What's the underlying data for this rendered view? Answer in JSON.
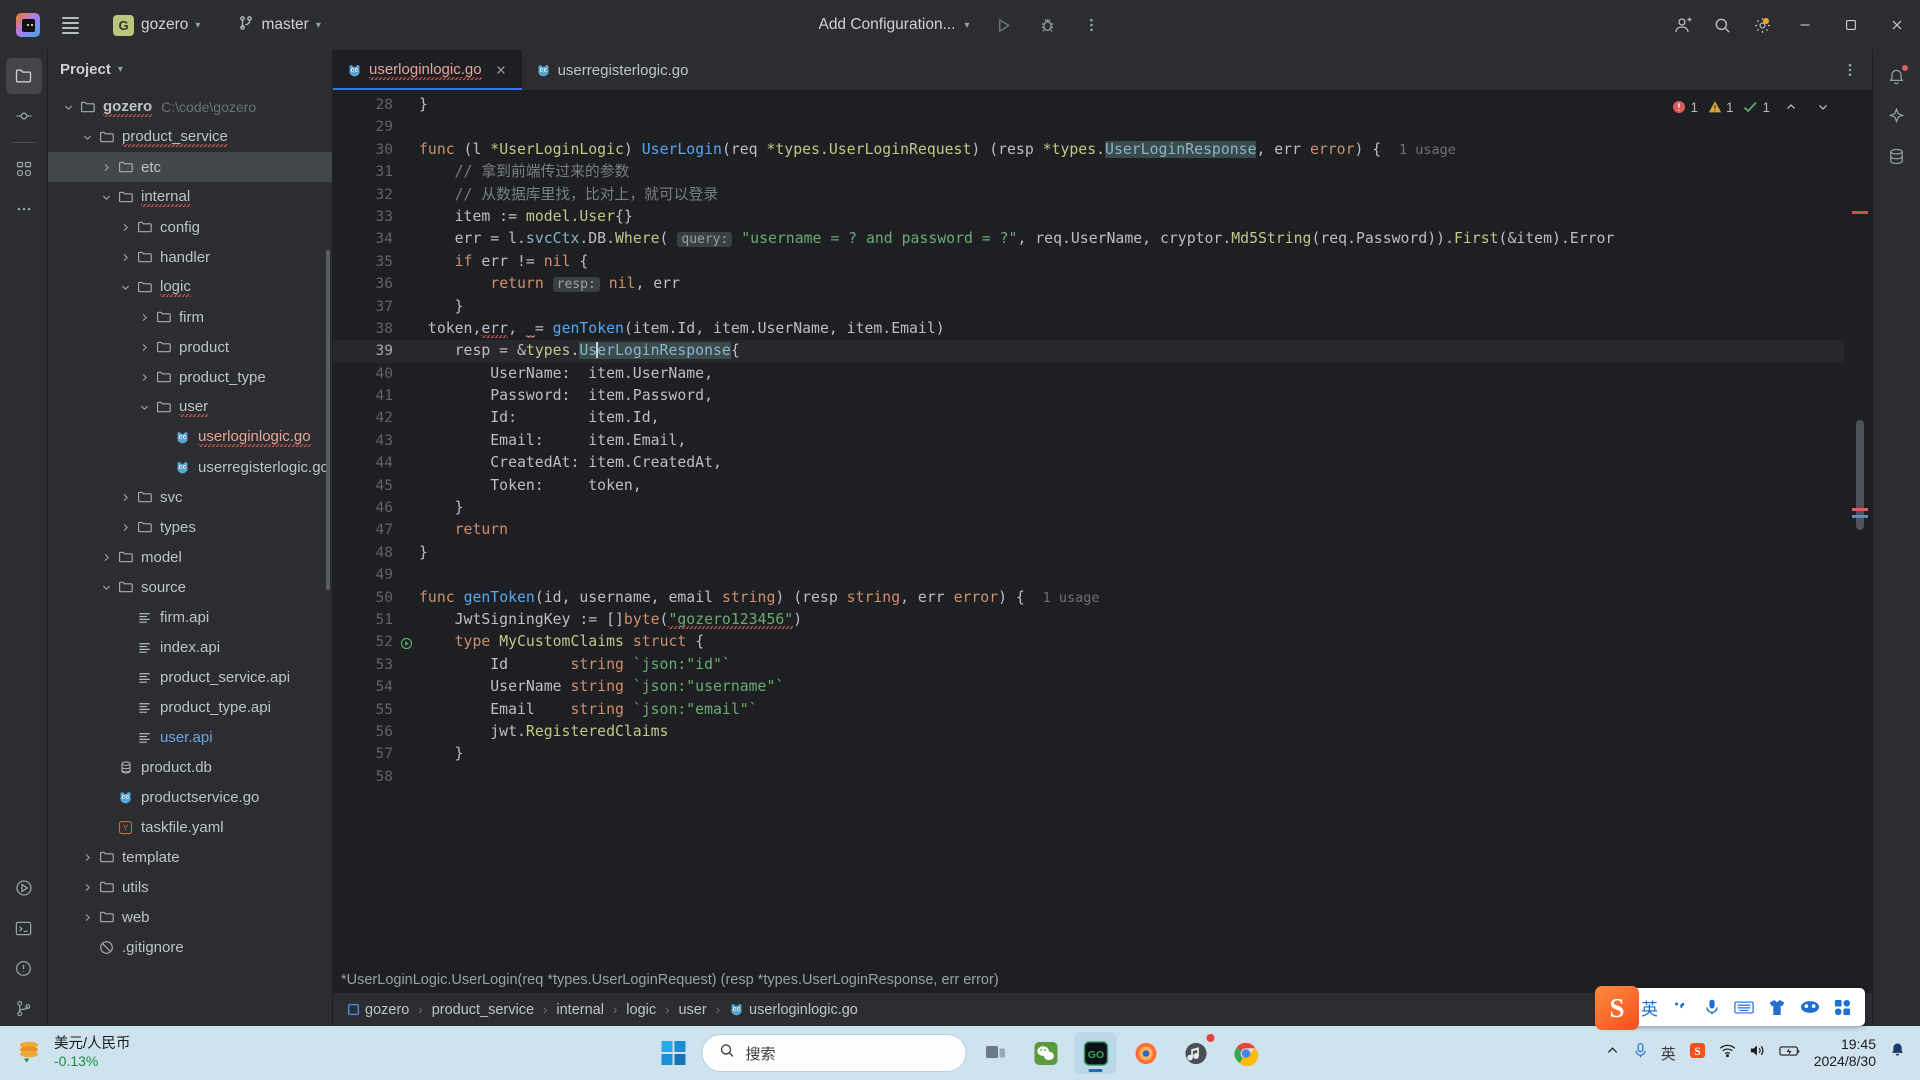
{
  "titlebar": {
    "menu_icon": "hamburger-icon",
    "project_initial": "G",
    "project_name": "gozero",
    "branch_icon": "git-branch-icon",
    "branch_name": "master",
    "run_config": "Add Configuration...",
    "run_icon": "run-icon",
    "debug_icon": "debug-icon",
    "more_icon": "more-vertical-icon",
    "account_icon": "account-icon",
    "search_icon": "search-icon",
    "settings_icon": "settings-icon",
    "minimize": "minimize-icon",
    "maximize": "maximize-icon",
    "close": "close-icon"
  },
  "tool_strip": {
    "items": [
      {
        "name": "project-icon",
        "active": true
      },
      {
        "name": "commit-icon",
        "active": false
      },
      {
        "name": "structure-icon",
        "active": false
      },
      {
        "name": "more-tools-icon",
        "active": false
      },
      {
        "name": "run-tool-icon",
        "active": false
      },
      {
        "name": "terminal-icon",
        "active": false
      },
      {
        "name": "problems-icon",
        "active": false
      },
      {
        "name": "version-control-icon",
        "active": false
      }
    ]
  },
  "right_strip": {
    "items": [
      {
        "name": "notifications-icon"
      },
      {
        "name": "ai-assistant-icon"
      },
      {
        "name": "database-icon"
      }
    ]
  },
  "project_panel": {
    "title": "Project",
    "tree": [
      {
        "indent": 0,
        "arrow": "down",
        "icon": "folder-icon",
        "label": "gozero",
        "sub": "C:\\code\\gozero",
        "style": "bold-squiggle"
      },
      {
        "indent": 1,
        "arrow": "down",
        "icon": "folder-icon",
        "label": "product_service",
        "style": "squiggle"
      },
      {
        "indent": 2,
        "arrow": "right",
        "icon": "folder-icon",
        "label": "etc",
        "selected": true
      },
      {
        "indent": 2,
        "arrow": "down",
        "icon": "folder-icon",
        "label": "internal",
        "style": "squiggle"
      },
      {
        "indent": 3,
        "arrow": "right",
        "icon": "folder-icon",
        "label": "config"
      },
      {
        "indent": 3,
        "arrow": "right",
        "icon": "folder-icon",
        "label": "handler"
      },
      {
        "indent": 3,
        "arrow": "down",
        "icon": "folder-icon",
        "label": "logic",
        "style": "squiggle"
      },
      {
        "indent": 4,
        "arrow": "right",
        "icon": "folder-icon",
        "label": "firm"
      },
      {
        "indent": 4,
        "arrow": "right",
        "icon": "folder-icon",
        "label": "product"
      },
      {
        "indent": 4,
        "arrow": "right",
        "icon": "folder-icon",
        "label": "product_type"
      },
      {
        "indent": 4,
        "arrow": "down",
        "icon": "folder-icon",
        "label": "user",
        "style": "squiggle"
      },
      {
        "indent": 5,
        "arrow": "none",
        "icon": "go-file-icon",
        "label": "userloginlogic.go",
        "style": "go-selected-squiggle"
      },
      {
        "indent": 5,
        "arrow": "none",
        "icon": "go-file-icon",
        "label": "userregisterlogic.go"
      },
      {
        "indent": 3,
        "arrow": "right",
        "icon": "folder-icon",
        "label": "svc"
      },
      {
        "indent": 3,
        "arrow": "right",
        "icon": "folder-icon",
        "label": "types"
      },
      {
        "indent": 2,
        "arrow": "right",
        "icon": "folder-icon",
        "label": "model"
      },
      {
        "indent": 2,
        "arrow": "down",
        "icon": "folder-icon",
        "label": "source"
      },
      {
        "indent": 3,
        "arrow": "none",
        "icon": "api-file-icon",
        "label": "firm.api"
      },
      {
        "indent": 3,
        "arrow": "none",
        "icon": "api-file-icon",
        "label": "index.api"
      },
      {
        "indent": 3,
        "arrow": "none",
        "icon": "api-file-icon",
        "label": "product_service.api"
      },
      {
        "indent": 3,
        "arrow": "none",
        "icon": "api-file-icon",
        "label": "product_type.api"
      },
      {
        "indent": 3,
        "arrow": "none",
        "icon": "api-file-icon",
        "label": "user.api",
        "style": "blue"
      },
      {
        "indent": 2,
        "arrow": "none",
        "icon": "db-file-icon",
        "label": "product.db"
      },
      {
        "indent": 2,
        "arrow": "none",
        "icon": "go-file-icon",
        "label": "productservice.go"
      },
      {
        "indent": 2,
        "arrow": "none",
        "icon": "yaml-file-icon",
        "label": "taskfile.yaml"
      },
      {
        "indent": 1,
        "arrow": "right",
        "icon": "folder-icon",
        "label": "template"
      },
      {
        "indent": 1,
        "arrow": "right",
        "icon": "folder-icon",
        "label": "utils"
      },
      {
        "indent": 1,
        "arrow": "right",
        "icon": "folder-icon",
        "label": "web"
      },
      {
        "indent": 1,
        "arrow": "none",
        "icon": "gitignore-icon",
        "label": ".gitignore"
      }
    ]
  },
  "editor": {
    "tabs": [
      {
        "label": "userloginlogic.go",
        "icon": "go-file-icon",
        "active": true,
        "closable": true
      },
      {
        "label": "userregisterlogic.go",
        "icon": "go-file-icon",
        "active": false,
        "closable": false
      }
    ],
    "inspections": {
      "errors": "1",
      "warnings": "1",
      "checks": "1",
      "error_icon": "error-icon",
      "warning_icon": "warning-icon",
      "check_icon": "check-icon",
      "up_icon": "chevron-up-icon",
      "down_icon": "chevron-down-icon"
    },
    "first_line_number": 28,
    "current_line": 39,
    "lines": [
      {
        "n": 28,
        "html": "<span class=\"ind1\"></span>}"
      },
      {
        "n": 29,
        "html": ""
      },
      {
        "n": 30,
        "html": "<span class=\"k\">func</span> (l <span class=\"pkg\">*UserLoginLogic</span>) <span class=\"fn\">UserLogin</span>(req <span class=\"pkg\">*types.UserLoginRequest</span>) (resp <span class=\"pkg\">*types.</span><span class=\"hl-occ teal\">UserLoginResponse</span>, err <span class=\"k\">error</span>) {  <span class=\"usage\">1 usage</span>"
      },
      {
        "n": 31,
        "html": "    <span class=\"cmt\">// 拿到前端传过来的参数</span>"
      },
      {
        "n": 32,
        "html": "    <span class=\"cmt\">// 从数据库里找，比对上，就可以登录</span>"
      },
      {
        "n": 33,
        "html": "    item := <span class=\"pkg\">model.User</span>{}"
      },
      {
        "n": 34,
        "html": "    err = l.<span class=\"teal\">svcCtx</span>.DB.<span class=\"pkg\">Where</span>( <span class=\"hint\">query:</span> <span class=\"str\">\"username = ? and password = ?\"</span>, req.UserName, cryptor.<span class=\"pkg\">Md5String</span>(req.Password)).<span class=\"pkg\">First</span>(&item).Error"
      },
      {
        "n": 35,
        "html": "    <span class=\"k\">if</span> err != <span class=\"k\">nil</span> {"
      },
      {
        "n": 36,
        "html": "        <span class=\"k\">return</span> <span class=\"hint\">resp:</span> <span class=\"k\">nil</span>, err"
      },
      {
        "n": 37,
        "html": "    }"
      },
      {
        "n": 38,
        "html": " token,<span class=\"err-underline\">err</span>, <span class=\"err-underline\">_</span>= <span class=\"fn\">genToken</span>(item.Id, item.UserName, item.Email)"
      },
      {
        "n": 39,
        "html": "    resp = &amp;<span class=\"pkg\">types.</span><span class=\"hl-occ teal\">Us<span class=\"caret\"></span>erLoginResponse</span>{",
        "current": true
      },
      {
        "n": 40,
        "html": "        UserName:  item.UserName,"
      },
      {
        "n": 41,
        "html": "        Password:  item.Password,"
      },
      {
        "n": 42,
        "html": "        Id:        item.Id,"
      },
      {
        "n": 43,
        "html": "        Email:     item.Email,"
      },
      {
        "n": 44,
        "html": "        CreatedAt: item.CreatedAt,"
      },
      {
        "n": 45,
        "html": "        Token:     token,"
      },
      {
        "n": 46,
        "html": "    }"
      },
      {
        "n": 47,
        "html": "    <span class=\"k\">return</span>"
      },
      {
        "n": 48,
        "html": "}"
      },
      {
        "n": 49,
        "html": ""
      },
      {
        "n": 50,
        "html": "<span class=\"k\">func</span> <span class=\"fn\">genToken</span>(id, username, email <span class=\"k\">string</span>) (resp <span class=\"k\">string</span>, err <span class=\"k\">error</span>) {  <span class=\"usage\">1 usage</span>"
      },
      {
        "n": 51,
        "html": "    JwtSigningKey := []<span class=\"k\">byte</span>(<span class=\"str\"><span class=\"err-underline\">\"gozero123456\"</span></span>)"
      },
      {
        "n": 52,
        "html": "    <span class=\"k\">type</span> <span class=\"pkg\">MyCustomClaims</span> <span class=\"k\">struct</span> {",
        "gutter_icon": "run-gutter-icon"
      },
      {
        "n": 53,
        "html": "        Id       <span class=\"k\">string</span> <span class=\"str\">`json:\"id\"`</span>"
      },
      {
        "n": 54,
        "html": "        UserName <span class=\"k\">string</span> <span class=\"str\">`json:\"username\"`</span>"
      },
      {
        "n": 55,
        "html": "        Email    <span class=\"k\">string</span> <span class=\"str\">`json:\"email\"`</span>"
      },
      {
        "n": 56,
        "html": "        jwt.<span class=\"pkg\">RegisteredClaims</span>"
      },
      {
        "n": 57,
        "html": "    }"
      },
      {
        "n": 58,
        "html": ""
      }
    ],
    "signature": "*UserLoginLogic.UserLogin(req *types.UserLoginRequest) (resp *types.UserLoginResponse, err error)"
  },
  "breadcrumb": {
    "items": [
      {
        "label": "gozero",
        "icon": "module-icon"
      },
      {
        "label": "product_service"
      },
      {
        "label": "internal"
      },
      {
        "label": "logic"
      },
      {
        "label": "user"
      },
      {
        "label": "userloginlogic.go",
        "icon": "go-file-icon"
      }
    ],
    "separator": "›"
  },
  "taskbar": {
    "stock_name": "美元/人民币",
    "stock_change": "-0.13%",
    "stock_icon": "coins-icon",
    "start_icon": "windows-start-icon",
    "search_placeholder": "搜索",
    "search_icon": "search-icon",
    "apps": [
      {
        "name": "task-view-icon",
        "active": false
      },
      {
        "name": "wechat-icon",
        "active": false
      },
      {
        "name": "goland-icon",
        "active": true
      },
      {
        "name": "firefox-icon",
        "active": false
      },
      {
        "name": "music-icon",
        "active": false
      },
      {
        "name": "chrome-icon",
        "active": false
      }
    ],
    "tray": [
      {
        "name": "show-hidden-icons-icon"
      },
      {
        "name": "microphone-icon"
      },
      {
        "name": "ime-english-icon"
      },
      {
        "name": "sogou-icon"
      },
      {
        "name": "wifi-icon"
      },
      {
        "name": "volume-icon"
      },
      {
        "name": "battery-icon"
      }
    ],
    "time": "19:45",
    "date": "2024/8/30",
    "notification_icon": "bell-icon"
  },
  "ime_popup": {
    "logo": "S",
    "mode": "英",
    "items": [
      {
        "name": "ime-mode-label",
        "label": "英"
      },
      {
        "name": "ime-punctuation-icon"
      },
      {
        "name": "ime-voice-icon"
      },
      {
        "name": "ime-keyboard-icon"
      },
      {
        "name": "ime-skin-icon"
      },
      {
        "name": "ime-emoji-icon"
      },
      {
        "name": "ime-toolbox-icon"
      }
    ]
  },
  "colors": {
    "accent": "#3574f0",
    "bg_editor": "#1e1f22",
    "bg_panel": "#2b2d30",
    "selected_tab_text": "#e8a49a",
    "taskbar": "#cfe3ef"
  }
}
